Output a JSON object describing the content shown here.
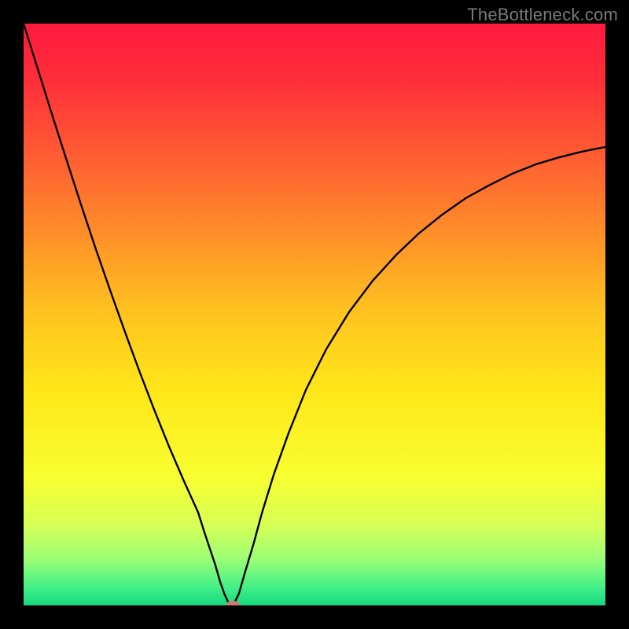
{
  "watermark": "TheBottleneck.com",
  "colors": {
    "frame": "#000000",
    "line": "#000000",
    "marker": "#cf7a78",
    "gradient_stops": [
      {
        "offset": 0.0,
        "color": "#ff1a3e"
      },
      {
        "offset": 0.1,
        "color": "#ff2f3a"
      },
      {
        "offset": 0.22,
        "color": "#ff5a33"
      },
      {
        "offset": 0.35,
        "color": "#ff8a2a"
      },
      {
        "offset": 0.5,
        "color": "#ffc41f"
      },
      {
        "offset": 0.63,
        "color": "#ffe619"
      },
      {
        "offset": 0.78,
        "color": "#f8ff30"
      },
      {
        "offset": 0.86,
        "color": "#d8ff55"
      },
      {
        "offset": 0.92,
        "color": "#9cff75"
      },
      {
        "offset": 0.97,
        "color": "#40ef88"
      },
      {
        "offset": 1.0,
        "color": "#18d87f"
      }
    ]
  },
  "chart_data": {
    "type": "line",
    "title": "",
    "xlabel": "",
    "ylabel": "",
    "xlim": [
      0,
      1
    ],
    "ylim": [
      0,
      1
    ],
    "series": [
      {
        "name": "curve",
        "x": [
          0.0,
          0.025,
          0.05,
          0.075,
          0.1,
          0.125,
          0.15,
          0.175,
          0.2,
          0.225,
          0.25,
          0.275,
          0.3,
          0.31,
          0.32,
          0.33,
          0.338,
          0.345,
          0.352,
          0.36,
          0.37,
          0.38,
          0.395,
          0.41,
          0.43,
          0.455,
          0.485,
          0.52,
          0.56,
          0.6,
          0.64,
          0.68,
          0.72,
          0.76,
          0.8,
          0.84,
          0.88,
          0.92,
          0.96,
          1.0
        ],
        "y": [
          1.0,
          0.92,
          0.84,
          0.762,
          0.685,
          0.61,
          0.538,
          0.468,
          0.4,
          0.335,
          0.273,
          0.215,
          0.16,
          0.128,
          0.098,
          0.068,
          0.04,
          0.02,
          0.005,
          0.0,
          0.02,
          0.055,
          0.105,
          0.16,
          0.225,
          0.295,
          0.37,
          0.44,
          0.505,
          0.558,
          0.602,
          0.64,
          0.672,
          0.7,
          0.722,
          0.742,
          0.758,
          0.77,
          0.78,
          0.788
        ]
      }
    ],
    "marker": {
      "x": 0.36,
      "y": 0.0
    },
    "legend": []
  }
}
